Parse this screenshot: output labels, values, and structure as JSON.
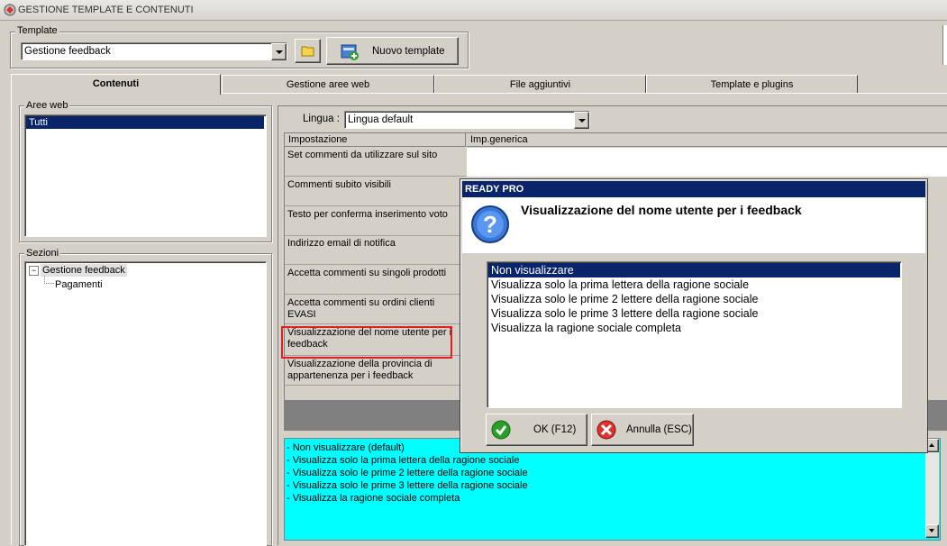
{
  "window": {
    "title": "GESTIONE TEMPLATE E CONTENUTI"
  },
  "template_group": {
    "label": "Template",
    "selected": "Gestione feedback",
    "new_button": "Nuovo template"
  },
  "tabs": [
    "Contenuti",
    "Gestione aree web",
    "File aggiuntivi",
    "Template e plugins"
  ],
  "aree_web": {
    "label": "Aree web",
    "items": [
      "Tutti"
    ]
  },
  "sezioni": {
    "label": "Sezioni",
    "root": "Gestione feedback",
    "child": "Pagamenti"
  },
  "lingua": {
    "label": "Lingua :",
    "selected": "Lingua default"
  },
  "grid": {
    "columns": [
      "Impostazione",
      "Imp.generica"
    ],
    "rows": [
      "Set commenti da utilizzare sul sito",
      "Commenti subito visibili",
      "Testo per conferma inserimento voto",
      "Indirizzo email di notifica",
      "Accetta commenti su singoli prodotti",
      "Accetta commenti su ordini clienti EVASI",
      "Visualizzazione del nome utente per i feedback",
      "Visualizzazione della provincia di appartenenza per i feedback"
    ]
  },
  "help_box": {
    "lines": [
      "- Non visualizzare (default)",
      "- Visualizza solo la prima lettera della ragione sociale",
      "- Visualizza solo le prime 2 lettere della ragione sociale",
      "- Visualizza solo le prime 3 lettere della ragione sociale",
      "- Visualizza la ragione sociale completa"
    ]
  },
  "dialog": {
    "title": "READY PRO",
    "heading": "Visualizzazione del nome utente per i feedback",
    "options": [
      "Non visualizzare",
      "Visualizza solo la prima lettera della ragione sociale",
      "Visualizza solo le prime 2 lettere della ragione sociale",
      "Visualizza solo le prime 3 lettere della ragione sociale",
      "Visualizza la ragione sociale completa"
    ],
    "ok_label": "OK (F12)",
    "cancel_label": "Annulla (ESC)"
  },
  "colors": {
    "selection": "#0a246a",
    "help_bg": "#00ffff",
    "highlight_border": "#e02020",
    "dialog_title": "#0a246a"
  }
}
